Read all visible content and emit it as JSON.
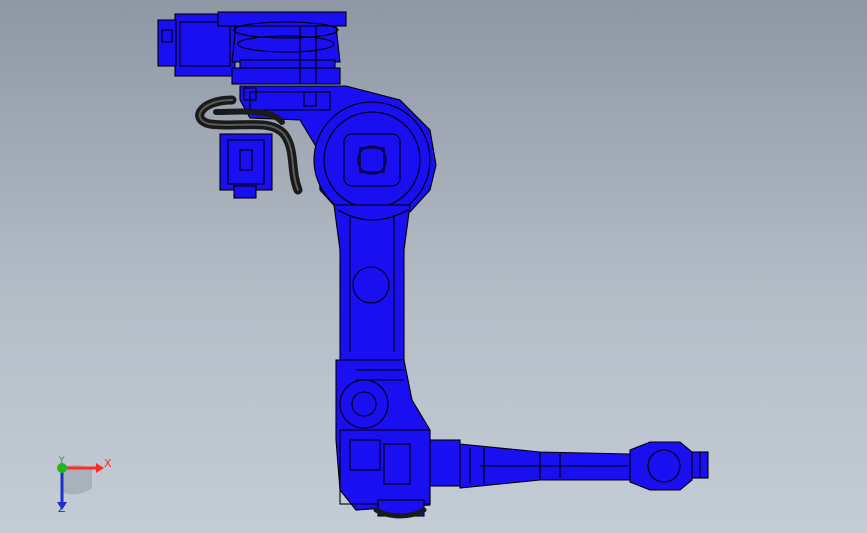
{
  "view": {
    "background_top": "#8e97a4",
    "background_bottom": "#c4ccd6"
  },
  "model": {
    "body_color": "#1a0ff0",
    "edge_color": "#000000",
    "cable_color": "#1a1a1a"
  },
  "triad": {
    "x_label": "X",
    "y_label": "Y",
    "z_label": "Z",
    "x_color": "#ff2a2a",
    "y_color": "#22b522",
    "z_color": "#1e2ecc"
  }
}
